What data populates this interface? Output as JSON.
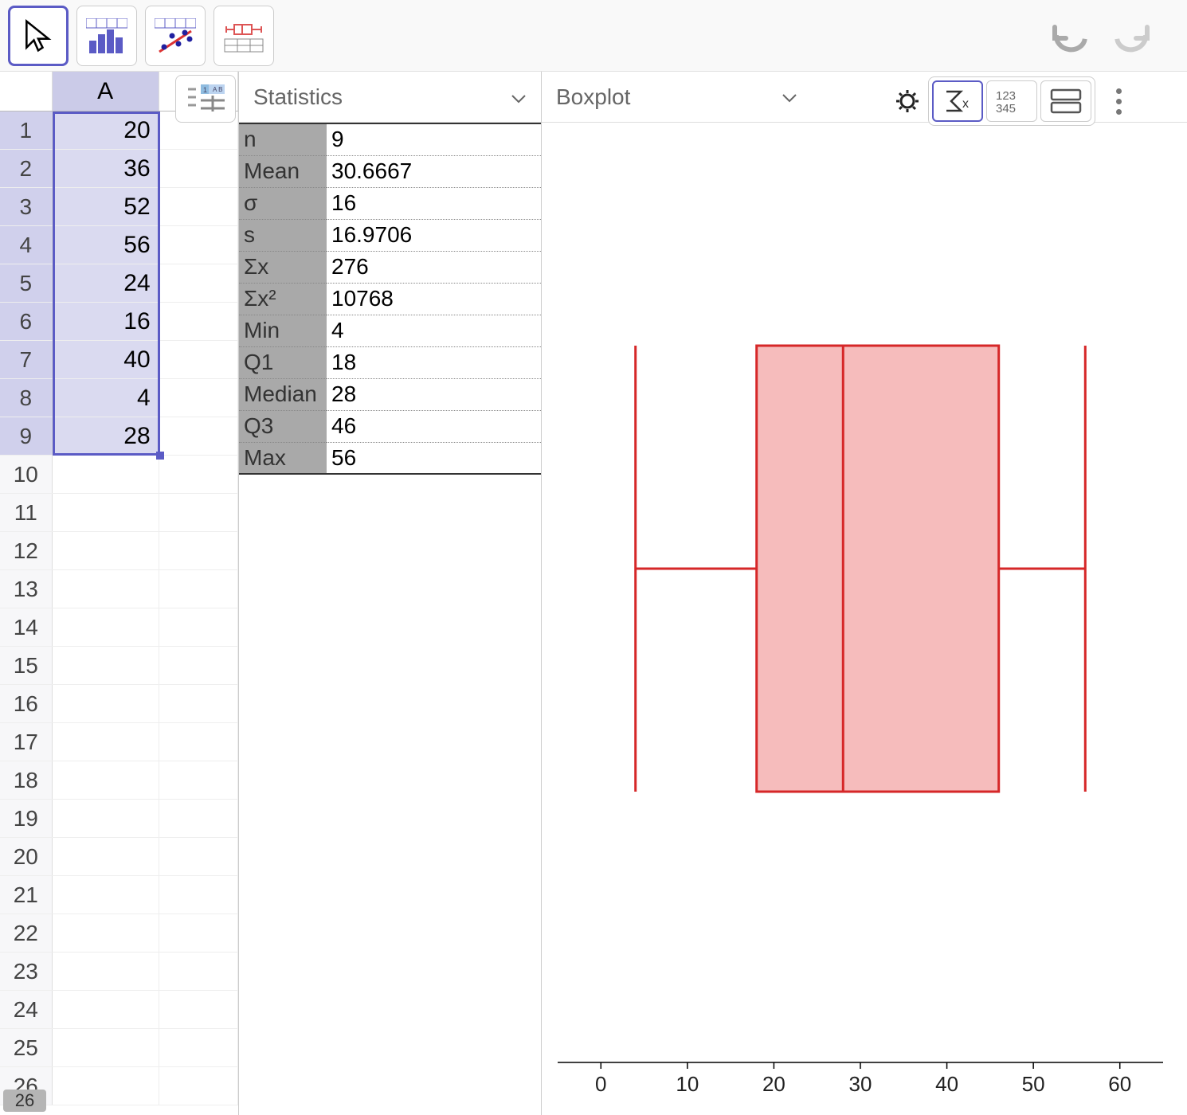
{
  "toolbar": {},
  "spreadsheet": {
    "col_header": "A",
    "rows": [
      {
        "num": "1",
        "val": "20"
      },
      {
        "num": "2",
        "val": "36"
      },
      {
        "num": "3",
        "val": "52"
      },
      {
        "num": "4",
        "val": "56"
      },
      {
        "num": "5",
        "val": "24"
      },
      {
        "num": "6",
        "val": "16"
      },
      {
        "num": "7",
        "val": "40"
      },
      {
        "num": "8",
        "val": "4"
      },
      {
        "num": "9",
        "val": "28"
      },
      {
        "num": "10",
        "val": ""
      },
      {
        "num": "11",
        "val": ""
      },
      {
        "num": "12",
        "val": ""
      },
      {
        "num": "13",
        "val": ""
      },
      {
        "num": "14",
        "val": ""
      },
      {
        "num": "15",
        "val": ""
      },
      {
        "num": "16",
        "val": ""
      },
      {
        "num": "17",
        "val": ""
      },
      {
        "num": "18",
        "val": ""
      },
      {
        "num": "19",
        "val": ""
      },
      {
        "num": "20",
        "val": ""
      },
      {
        "num": "21",
        "val": ""
      },
      {
        "num": "22",
        "val": ""
      },
      {
        "num": "23",
        "val": ""
      },
      {
        "num": "24",
        "val": ""
      },
      {
        "num": "25",
        "val": ""
      },
      {
        "num": "26",
        "val": ""
      }
    ],
    "status": "26",
    "selected_count": 9
  },
  "stats_panel": {
    "title": "Statistics",
    "rows": [
      {
        "k": "n",
        "v": "9"
      },
      {
        "k": "Mean",
        "v": "30.6667"
      },
      {
        "k": "σ",
        "v": "16"
      },
      {
        "k": "s",
        "v": "16.9706"
      },
      {
        "k": "Σx",
        "v": "276"
      },
      {
        "k": "Σx²",
        "v": "10768"
      },
      {
        "k": "Min",
        "v": "4"
      },
      {
        "k": "Q1",
        "v": "18"
      },
      {
        "k": "Median",
        "v": "28"
      },
      {
        "k": "Q3",
        "v": "46"
      },
      {
        "k": "Max",
        "v": "56"
      }
    ]
  },
  "chart_panel": {
    "title": "Boxplot"
  },
  "chart_data": {
    "type": "boxplot",
    "title": "Boxplot",
    "min": 4,
    "q1": 18,
    "median": 28,
    "q3": 46,
    "max": 56,
    "xticks": [
      0,
      10,
      20,
      30,
      40,
      50,
      60
    ],
    "xlim": [
      -5,
      65
    ],
    "xlabel": "",
    "ylabel": ""
  }
}
